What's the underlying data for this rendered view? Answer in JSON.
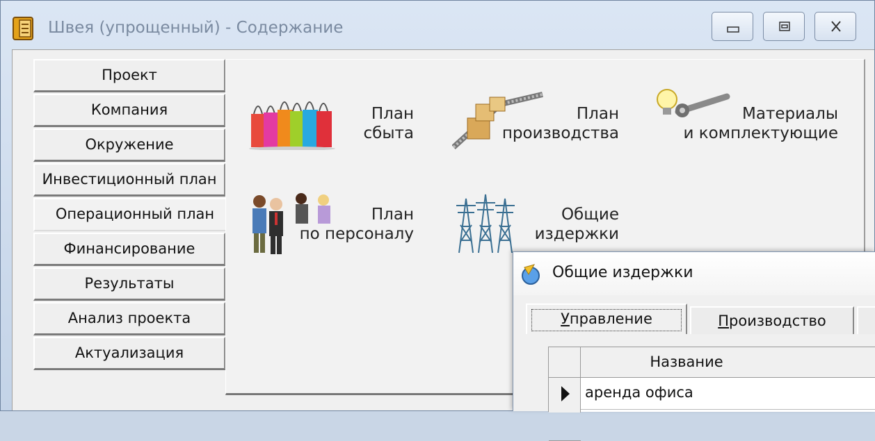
{
  "window": {
    "title": "Швея (упрощенный) - Содержание",
    "controls": [
      "minimize",
      "restore",
      "close"
    ]
  },
  "nav": {
    "active": "Операционный план",
    "items": [
      {
        "label": "Проект"
      },
      {
        "label": "Компания"
      },
      {
        "label": "Окружение"
      },
      {
        "label": "Инвестиционный план"
      },
      {
        "label": "Операционный план"
      },
      {
        "label": "Финансирование"
      },
      {
        "label": "Результаты"
      },
      {
        "label": "Анализ проекта"
      },
      {
        "label": "Актуализация"
      }
    ]
  },
  "items": {
    "sales": {
      "line1": "План",
      "line2": "сбыта",
      "icon": "shopping-bags-icon"
    },
    "production": {
      "line1": "План",
      "line2": "производства",
      "icon": "conveyor-boxes-icon"
    },
    "materials": {
      "line1": "Материалы",
      "line2": "и комплектующие",
      "icon": "bulb-wrench-icon"
    },
    "personnel": {
      "line1": "План",
      "line2": "по персоналу",
      "icon": "people-icon"
    },
    "overhead": {
      "line1": "Общие",
      "line2": "издержки",
      "icon": "power-tower-icon"
    }
  },
  "dialog": {
    "title": "Общие издержки",
    "tabs": [
      {
        "label_underlined": "У",
        "label_rest": "правление"
      },
      {
        "label_underlined": "П",
        "label_rest": "роизводство"
      }
    ],
    "grid": {
      "column_header": "Название",
      "rows": [
        "аренда офиса"
      ]
    }
  },
  "colors": {
    "titlebar": "#c3d3e7",
    "client_bg": "#f0f0f0",
    "title_text": "#7a8aa0"
  }
}
